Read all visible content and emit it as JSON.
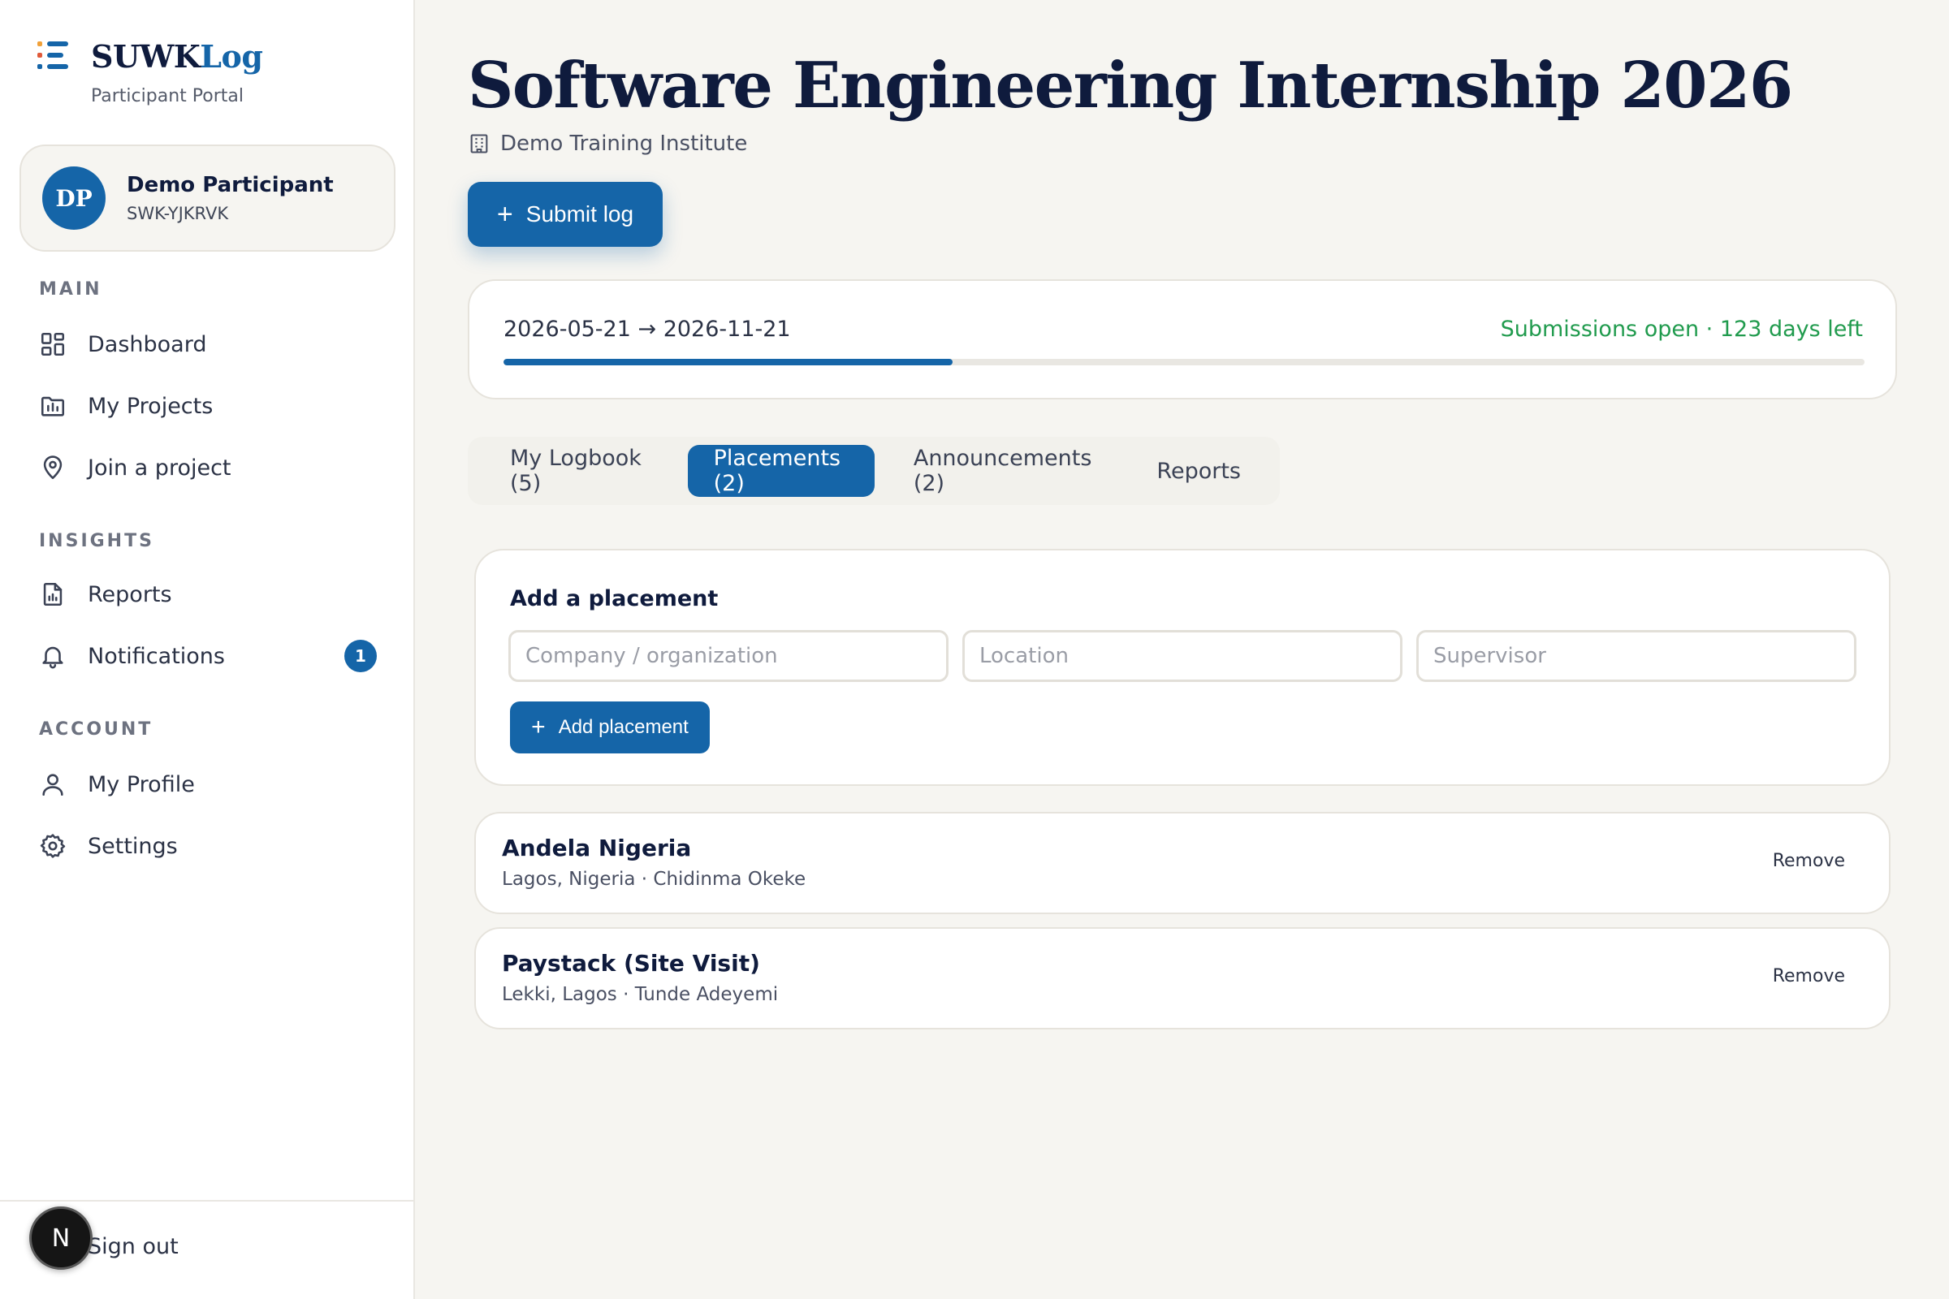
{
  "brand": {
    "name_prefix": "SUWK",
    "name_suffix": "Log",
    "subtitle": "Participant Portal"
  },
  "user": {
    "initials": "DP",
    "name": "Demo Participant",
    "id": "SWK-YJKRVK"
  },
  "sidebar": {
    "sections": [
      {
        "label": "MAIN",
        "items": [
          {
            "label": "Dashboard",
            "icon": "dashboard-icon"
          },
          {
            "label": "My Projects",
            "icon": "folder-icon"
          },
          {
            "label": "Join a project",
            "icon": "map-pin-icon"
          }
        ]
      },
      {
        "label": "INSIGHTS",
        "items": [
          {
            "label": "Reports",
            "icon": "report-icon"
          },
          {
            "label": "Notifications",
            "icon": "bell-icon",
            "badge": "1"
          }
        ]
      },
      {
        "label": "ACCOUNT",
        "items": [
          {
            "label": "My Profile",
            "icon": "user-icon"
          },
          {
            "label": "Settings",
            "icon": "gear-icon"
          }
        ]
      }
    ],
    "sign_out": "Sign out",
    "floating_badge": "N"
  },
  "page": {
    "title": "Software Engineering Internship 2026",
    "institute": "Demo Training Institute",
    "submit_label": "Submit log"
  },
  "period": {
    "range": "2026-05-21 → 2026-11-21",
    "status": "Submissions open · 123 days left",
    "progress_fraction": 0.33
  },
  "tabs": [
    {
      "label": "My Logbook (5)",
      "active": false
    },
    {
      "label": "Placements (2)",
      "active": true
    },
    {
      "label": "Announcements (2)",
      "active": false
    },
    {
      "label": "Reports",
      "active": false
    }
  ],
  "add_placement": {
    "title": "Add a placement",
    "company_placeholder": "Company / organization",
    "location_placeholder": "Location",
    "supervisor_placeholder": "Supervisor",
    "button_label": "Add placement"
  },
  "placements": [
    {
      "name": "Andela Nigeria",
      "meta": "Lagos, Nigeria · Chidinma Okeke",
      "remove_label": "Remove"
    },
    {
      "name": "Paystack (Site Visit)",
      "meta": "Lekki, Lagos · Tunde Adeyemi",
      "remove_label": "Remove"
    }
  ],
  "colors": {
    "accent": "#1565a8",
    "success": "#219b4e",
    "background": "#f6f5f1",
    "ink": "#0f1b3d"
  }
}
